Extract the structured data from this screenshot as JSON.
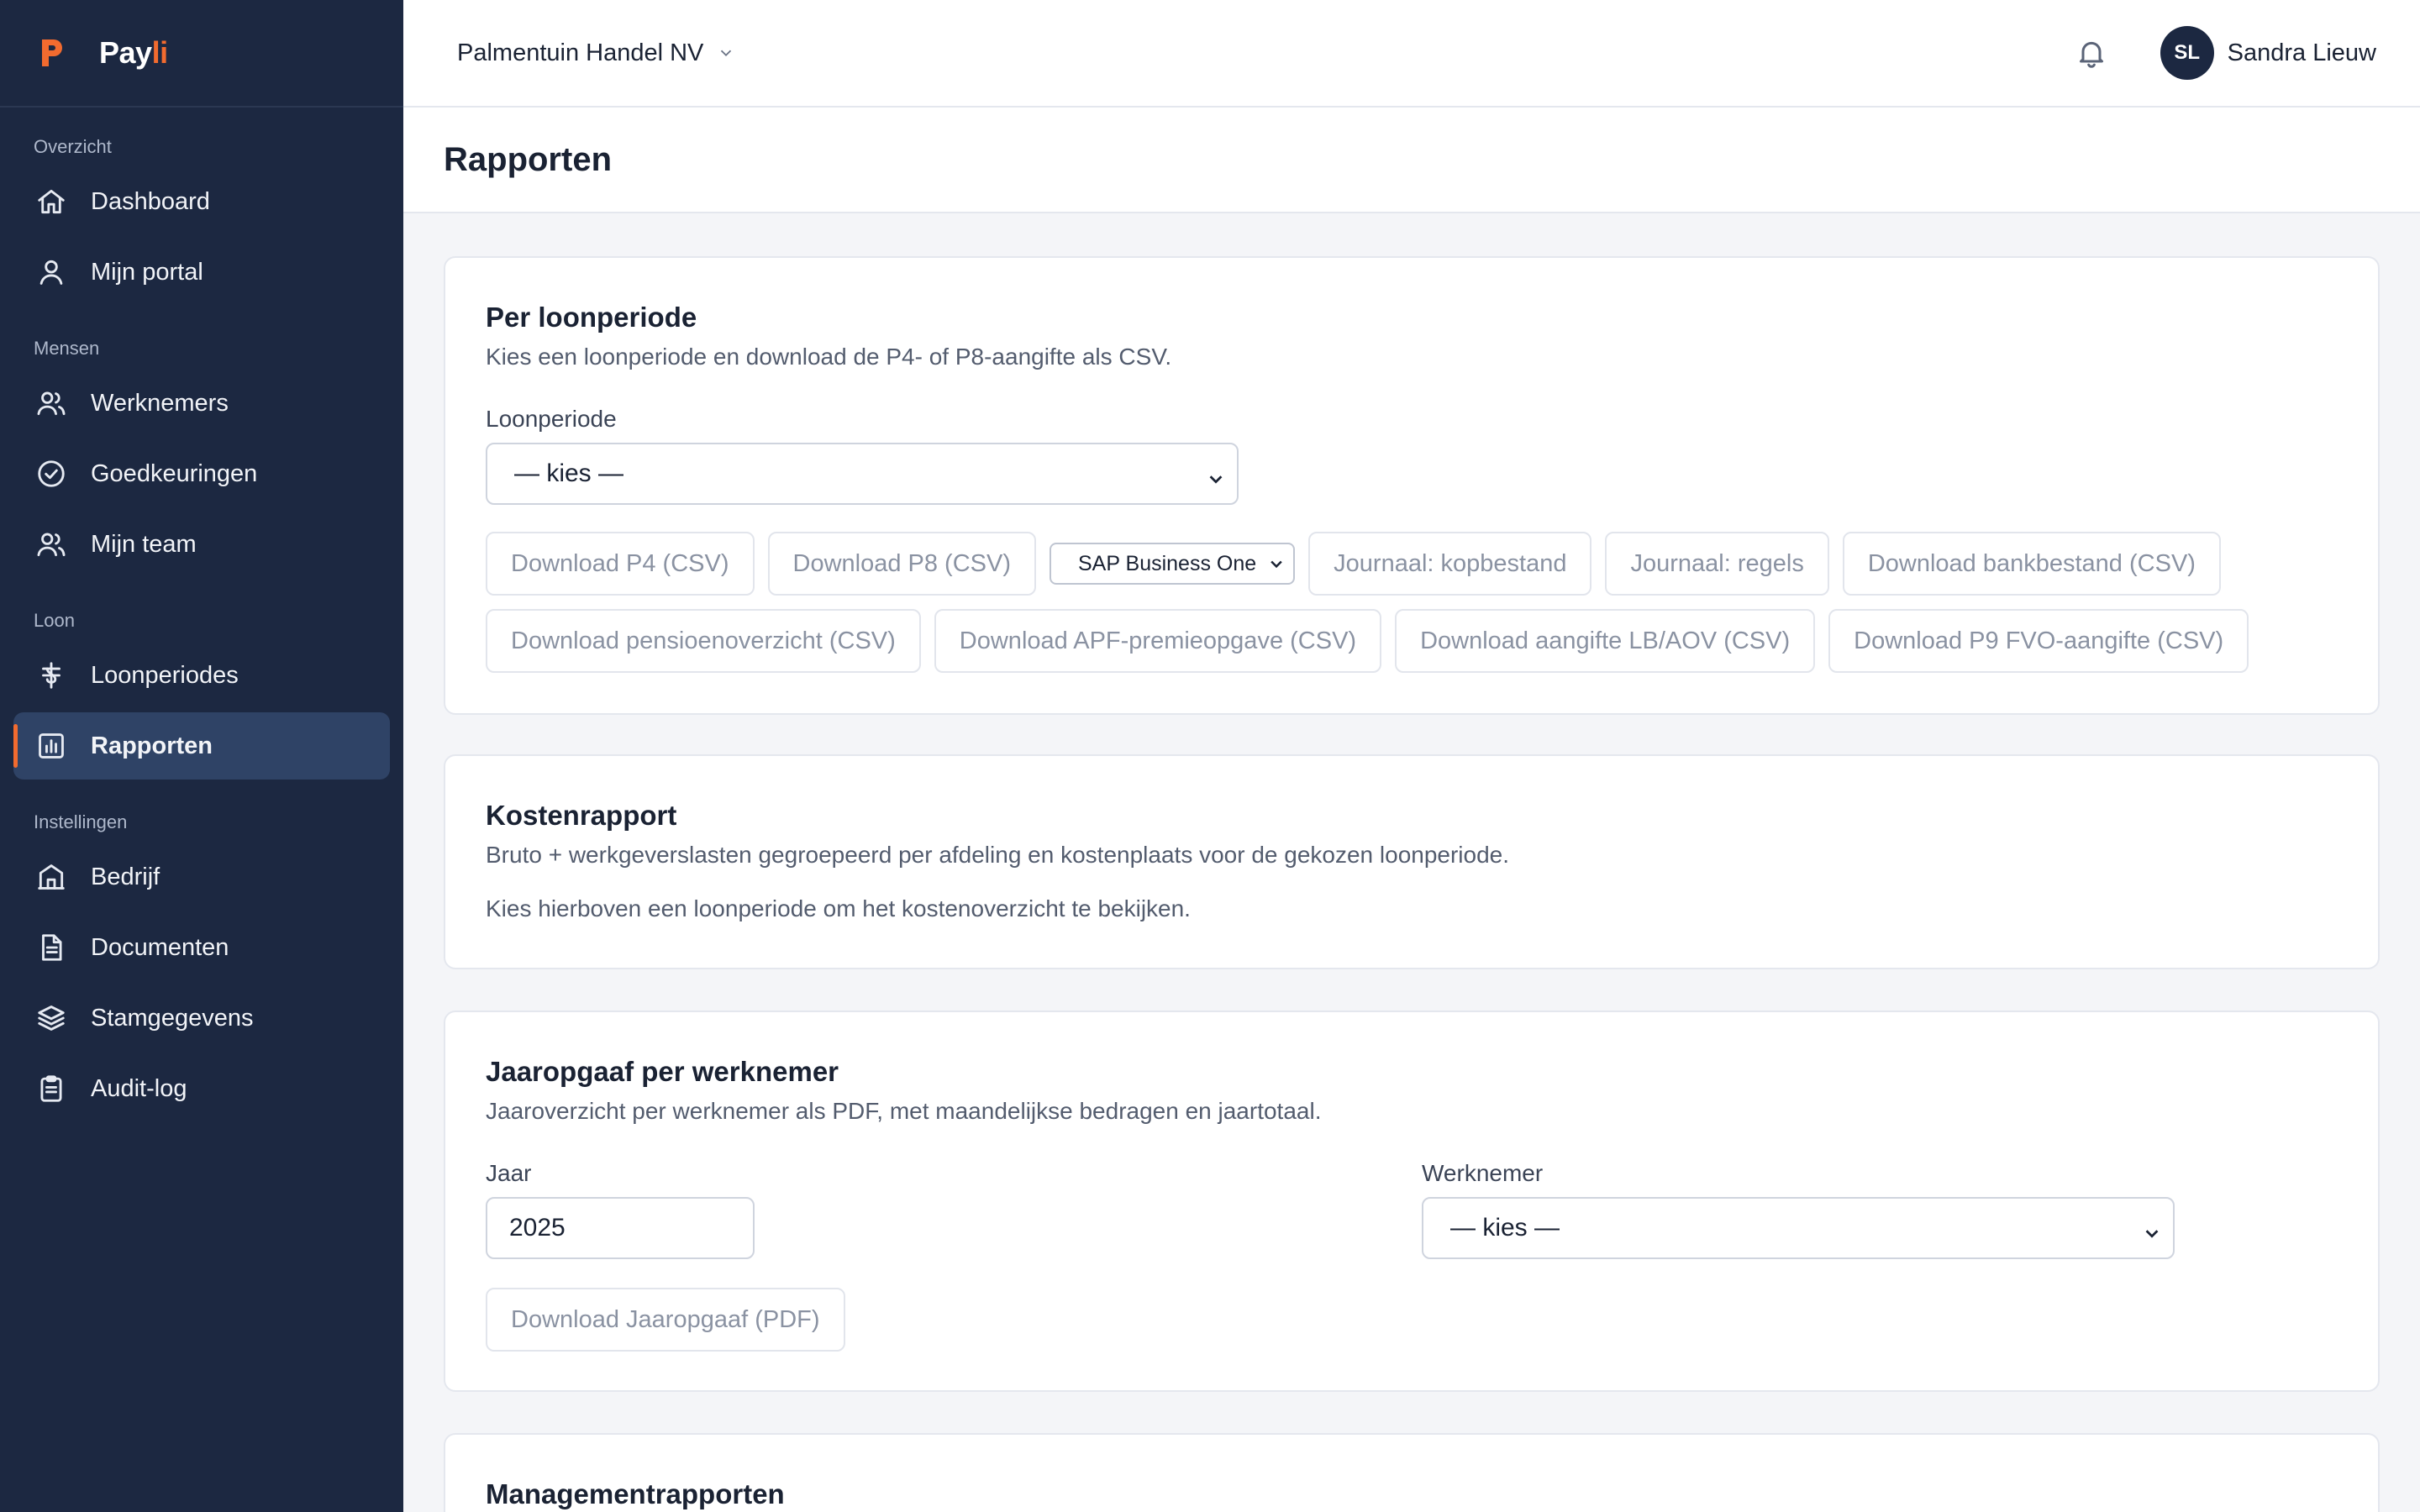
{
  "brand": {
    "name_main": "Pay",
    "name_accent": "li",
    "colors": {
      "sidebar": "#1c2841",
      "accent": "#f26b2f"
    }
  },
  "sidebar": {
    "sections": [
      {
        "label": "Overzicht",
        "items": [
          {
            "label": "Dashboard",
            "icon": "home-icon"
          },
          {
            "label": "Mijn portal",
            "icon": "user-icon"
          }
        ]
      },
      {
        "label": "Mensen",
        "items": [
          {
            "label": "Werknemers",
            "icon": "users-icon"
          },
          {
            "label": "Goedkeuringen",
            "icon": "check-circle-icon"
          },
          {
            "label": "Mijn team",
            "icon": "team-icon"
          }
        ]
      },
      {
        "label": "Loon",
        "items": [
          {
            "label": "Loonperiodes",
            "icon": "currency-icon"
          },
          {
            "label": "Rapporten",
            "icon": "bar-chart-icon",
            "active": true
          }
        ]
      },
      {
        "label": "Instellingen",
        "items": [
          {
            "label": "Bedrijf",
            "icon": "building-icon"
          },
          {
            "label": "Documenten",
            "icon": "document-icon"
          },
          {
            "label": "Stamgegevens",
            "icon": "layers-icon"
          },
          {
            "label": "Audit-log",
            "icon": "clipboard-icon"
          }
        ]
      }
    ]
  },
  "topbar": {
    "company": "Palmentuin Handel NV",
    "user": {
      "initials": "SL",
      "name": "Sandra Lieuw"
    }
  },
  "page": {
    "title": "Rapporten"
  },
  "per_period": {
    "title": "Per loonperiode",
    "description": "Kies een loonperiode en download de P4- of P8-aangifte als CSV.",
    "period_label": "Loonperiode",
    "period_value": "— kies —",
    "buttons": {
      "p4": "Download P4 (CSV)",
      "p8": "Download P8 (CSV)",
      "journal_system": "SAP Business One",
      "journal_header": "Journaal: kopbestand",
      "journal_lines": "Journaal: regels",
      "bank": "Download bankbestand (CSV)",
      "pension": "Download pensioenoverzicht (CSV)",
      "apf": "Download APF-premieopgave (CSV)",
      "lb_aov": "Download aangifte LB/AOV (CSV)",
      "p9": "Download P9 FVO-aangifte (CSV)"
    }
  },
  "cost_report": {
    "title": "Kostenrapport",
    "description": "Bruto + werkgeverslasten gegroepeerd per afdeling en kostenplaats voor de gekozen loonperiode.",
    "hint": "Kies hierboven een loonperiode om het kostenoverzicht te bekijken."
  },
  "annual": {
    "title": "Jaaropgaaf per werknemer",
    "description": "Jaaroverzicht per werknemer als PDF, met maandelijkse bedragen en jaartotaal.",
    "year_label": "Jaar",
    "year_value": "2025",
    "employee_label": "Werknemer",
    "employee_value": "— kies —",
    "download": "Download Jaaropgaaf (PDF)"
  },
  "management": {
    "title": "Managementrapporten"
  }
}
